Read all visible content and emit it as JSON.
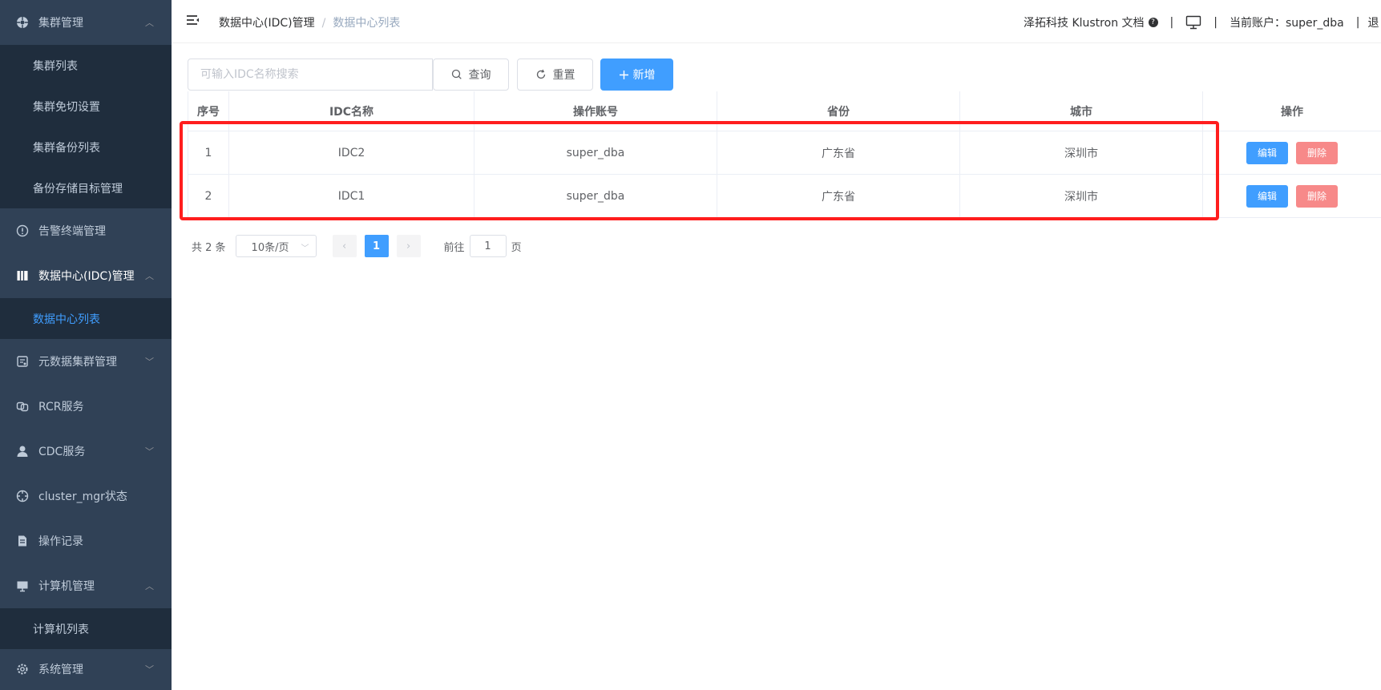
{
  "sidebar": {
    "groups": [
      {
        "label": "集群管理",
        "icon": "cluster-icon",
        "expanded": true,
        "children": [
          "集群列表",
          "集群免切设置",
          "集群备份列表",
          "备份存储目标管理"
        ]
      },
      {
        "label": "告警终端管理",
        "icon": "alert-icon"
      },
      {
        "label": "数据中心(IDC)管理",
        "icon": "datacenter-icon",
        "expanded": true,
        "children": [
          "数据中心列表"
        ],
        "active_child": "数据中心列表"
      },
      {
        "label": "元数据集群管理",
        "icon": "metadata-icon",
        "expanded": false
      },
      {
        "label": "RCR服务",
        "icon": "rcr-icon"
      },
      {
        "label": "CDC服务",
        "icon": "user-icon",
        "expanded": false
      },
      {
        "label": "cluster_mgr状态",
        "icon": "target-icon"
      },
      {
        "label": "操作记录",
        "icon": "record-icon"
      },
      {
        "label": "计算机管理",
        "icon": "monitor-icon",
        "expanded": true,
        "children": [
          "计算机列表"
        ]
      },
      {
        "label": "系统管理",
        "icon": "gear-icon",
        "expanded": false
      }
    ]
  },
  "header": {
    "breadcrumb": [
      "数据中心(IDC)管理",
      "数据中心列表"
    ],
    "docs_link": "泽拓科技 Klustron 文档",
    "account_label": "当前账户：super_dba",
    "logout_partial": "退"
  },
  "toolbar": {
    "search_placeholder": "可输入IDC名称搜索",
    "query_label": "查询",
    "reset_label": "重置",
    "add_label": "新增"
  },
  "table": {
    "columns": [
      "序号",
      "IDC名称",
      "操作账号",
      "省份",
      "城市",
      "操作"
    ],
    "rows": [
      {
        "index": "1",
        "idc_name": "IDC2",
        "account": "super_dba",
        "province": "广东省",
        "city": "深圳市"
      },
      {
        "index": "2",
        "idc_name": "IDC1",
        "account": "super_dba",
        "province": "广东省",
        "city": "深圳市"
      }
    ],
    "edit_label": "编辑",
    "delete_label": "删除"
  },
  "pagination": {
    "total": "共 2 条",
    "page_size": "10条/页",
    "current_page": "1",
    "goto_prefix": "前往",
    "goto_value": "1",
    "goto_suffix": "页"
  },
  "colors": {
    "sidebar_bg": "#304156",
    "submenu_bg": "#1f2d3d",
    "primary": "#409eff",
    "danger": "#f78989",
    "highlight": "#ff1e1e"
  }
}
